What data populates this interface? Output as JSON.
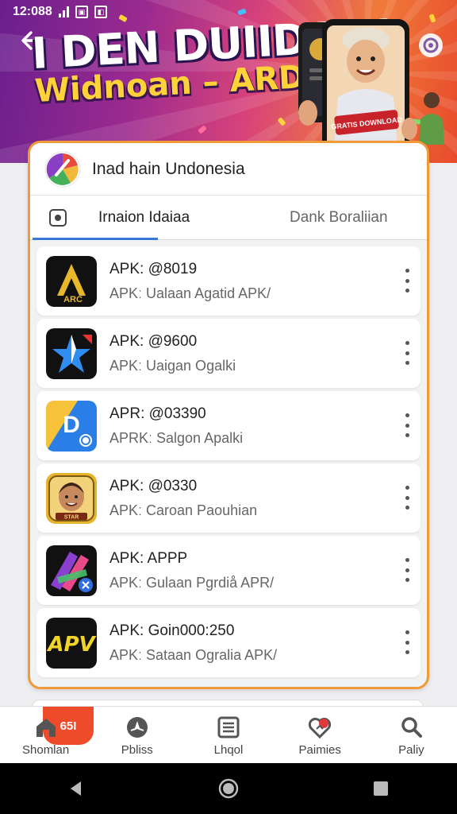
{
  "status_bar": {
    "time": "12:088"
  },
  "banner": {
    "title": "I DEN DUIIDAN!",
    "subtitle": "Widnoan – ARDS",
    "phone_ticket": "GRATIS DOWNLOAD"
  },
  "card": {
    "title": "Inad hain Undonesia",
    "tabs": [
      {
        "label": "Irnaion Idaiaa",
        "active": true
      },
      {
        "label": "Dank Boraliian",
        "active": false
      }
    ],
    "items": [
      {
        "title": "APK: @8019",
        "subtitle": "APKː Ualaan  Agatid  APK/",
        "icon": "gold-a-app-icon",
        "icon_text": "ARC"
      },
      {
        "title": "APK: @9600",
        "subtitle": "APKː Uaigan  Ogalki",
        "icon": "blue-star-app-icon"
      },
      {
        "title": "APR: @03390",
        "subtitle": "APRKː Salgon  Apalki",
        "icon": "yellow-d-app-icon",
        "icon_text": "D"
      },
      {
        "title": "APK: @0330",
        "subtitle": "APKː Caroan  Paouhian",
        "icon": "portrait-app-icon",
        "icon_text": "STAR"
      },
      {
        "title": "APK: APPP",
        "subtitle": "APKː Gulaan  Pgrdiå  APR/",
        "icon": "colorful-v-app-icon"
      },
      {
        "title": "APK: Goin000:250",
        "subtitle": "APKː Sataan  Ogralia  APK/",
        "icon": "apv-app-icon",
        "icon_text": "APV"
      }
    ]
  },
  "bottom_nav": {
    "badge": "65I",
    "items": [
      {
        "label": "Shomlan",
        "icon": "home-icon"
      },
      {
        "label": "Pbliss",
        "icon": "explore-icon"
      },
      {
        "label": "Lhqol",
        "icon": "list-icon"
      },
      {
        "label": "Paimies",
        "icon": "heart-icon"
      },
      {
        "label": "Paliy",
        "icon": "search-icon"
      }
    ]
  },
  "colors": {
    "accent_border": "#f09a3a",
    "tab_underline": "#3a78d8",
    "badge": "#ee4b2b"
  }
}
